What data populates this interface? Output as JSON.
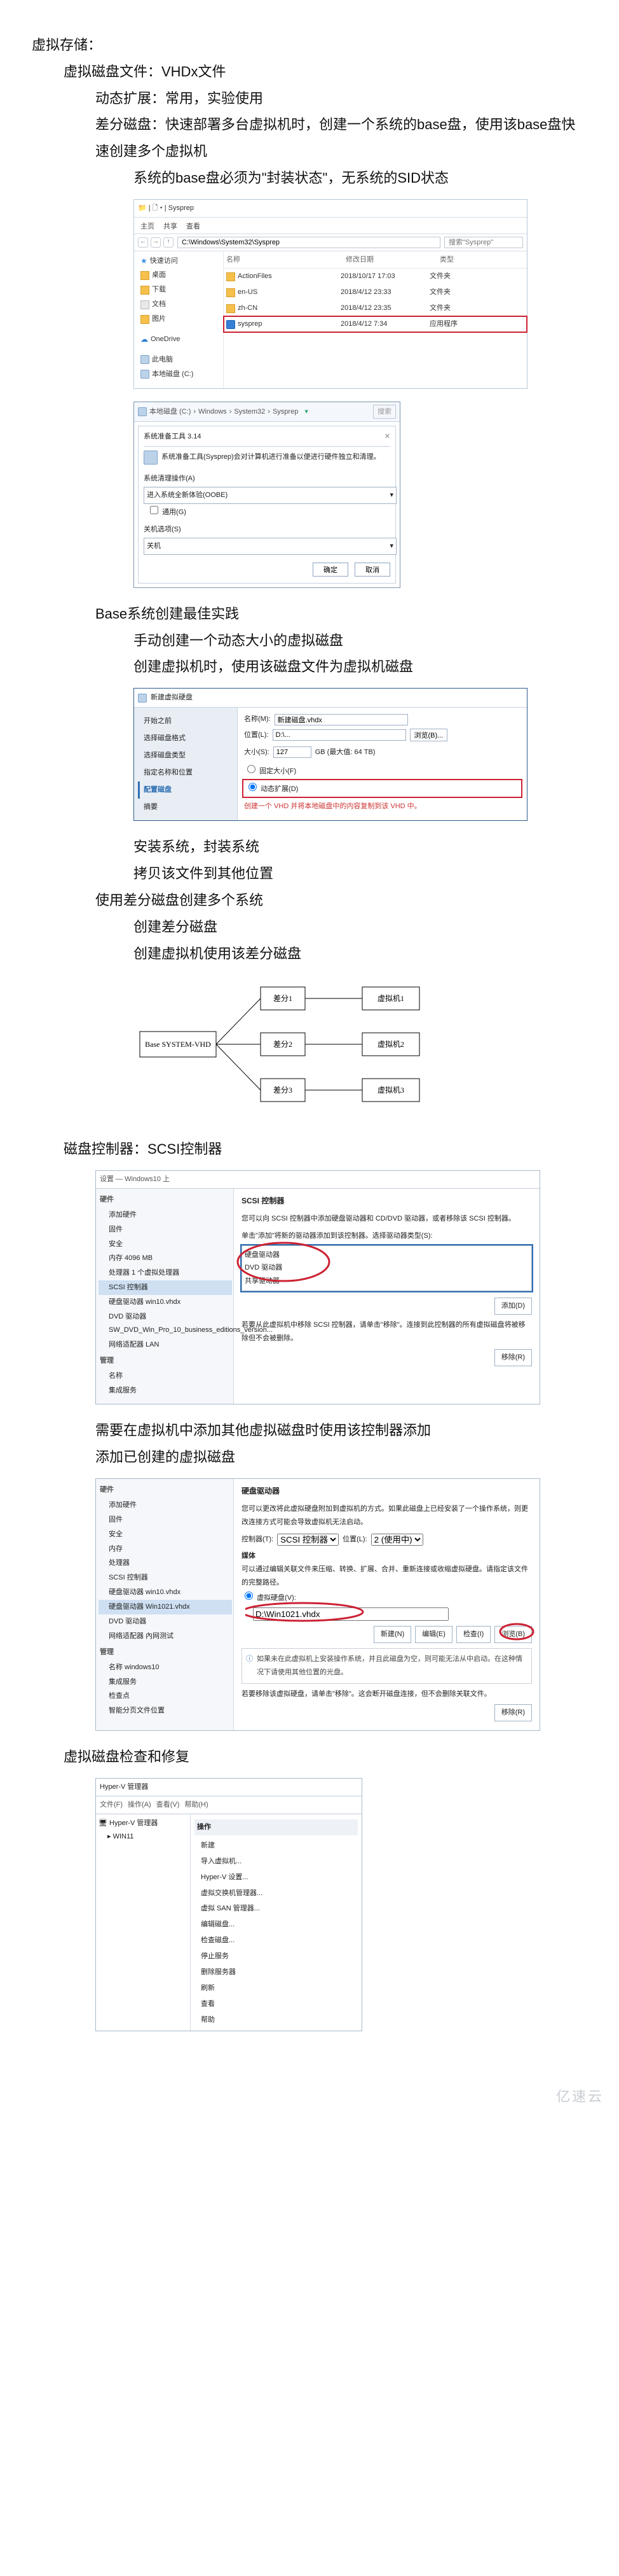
{
  "text": {
    "t0": "虚拟存储：",
    "t1": "虚拟磁盘文件：VHDx文件",
    "t2": "动态扩展：常用，实验使用",
    "t3": "差分磁盘：快速部署多台虚拟机时，创建一个系统的base盘，使用该base盘快速创建多个虚拟机",
    "t4": "系统的base盘必须为\"封装状态\"，无系统的SID状态",
    "t5": "Base系统创建最佳实践",
    "t6": "手动创建一个动态大小的虚拟磁盘",
    "t7": "创建虚拟机时，使用该磁盘文件为虚拟机磁盘",
    "t8": "安装系统，封装系统",
    "t9": "拷贝该文件到其他位置",
    "t10": "使用差分磁盘创建多个系统",
    "t11": "创建差分磁盘",
    "t12": "创建虚拟机使用该差分磁盘",
    "t13": "磁盘控制器：SCSI控制器",
    "t14": "需要在虚拟机中添加其他虚拟磁盘时使用该控制器添加",
    "t15": "添加已创建的虚拟磁盘",
    "t16": "虚拟磁盘检查和修复"
  },
  "explorer": {
    "title_prefix": "📁 | 🗋 ▾ |",
    "title": "Sysprep",
    "tabs": [
      "主页",
      "共享",
      "查看"
    ],
    "path": "C:\\Windows\\System32\\Sysprep",
    "search_placeholder": "搜索\"Sysprep\"",
    "cols": {
      "name": "名称",
      "date": "修改日期",
      "type": "类型"
    },
    "tree": [
      {
        "icon": "star",
        "label": "快速访问"
      },
      {
        "icon": "folder",
        "label": "桌面"
      },
      {
        "icon": "folder",
        "label": "下载"
      },
      {
        "icon": "file",
        "label": "文档"
      },
      {
        "icon": "folder",
        "label": "图片"
      },
      {
        "icon": "cloud",
        "label": "OneDrive"
      },
      {
        "icon": "drive",
        "label": "此电脑"
      },
      {
        "icon": "drive",
        "label": "本地磁盘 (C:)"
      }
    ],
    "rows": [
      {
        "icon": "folder",
        "name": "ActionFiles",
        "date": "2018/10/17 17:03",
        "type": "文件夹"
      },
      {
        "icon": "folder",
        "name": "en-US",
        "date": "2018/4/12 23:33",
        "type": "文件夹"
      },
      {
        "icon": "folder",
        "name": "zh-CN",
        "date": "2018/4/12 23:35",
        "type": "文件夹"
      },
      {
        "icon": "app",
        "name": "sysprep",
        "date": "2018/4/12 7:34",
        "type": "应用程序"
      }
    ]
  },
  "sysprep": {
    "crumbs": [
      "本地磁盘 (C:)",
      "Windows",
      "System32",
      "Sysprep"
    ],
    "srchph": "搜索",
    "title": "系统准备工具 3.14",
    "desc": "系统准备工具(Sysprep)会对计算机进行准备以便进行硬件独立和清理。",
    "f1": "系统清理操作(A)",
    "sel1": "进入系统全新体验(OOBE)",
    "chk": "通用(G)",
    "f2": "关机选项(S)",
    "sel2": "关机",
    "ok": "确定",
    "cancel": "取消"
  },
  "newvhd": {
    "title": "新建虚拟硬盘",
    "steps": [
      "开始之前",
      "选择磁盘格式",
      "选择磁盘类型",
      "指定名称和位置",
      "配置磁盘",
      "摘要"
    ],
    "cur": 4,
    "nameL": "名称(M):",
    "nameV": "新建磁盘.vhdx",
    "locL": "位置(L):",
    "locV": "D:\\...",
    "browse": "浏览(B)...",
    "sizeL": "大小(S):",
    "sizeV": "127",
    "sizeU": "GB (最大值: 64 TB)",
    "opt_fixed": "固定大小(F)",
    "opt_dyn": "动态扩展(D)",
    "note": "创建一个 VHD 并将本地磁盘中的内容复制到该 VHD 中。"
  },
  "diff": {
    "base": "Base SYSTEM-VHD",
    "d": [
      "差分1",
      "差分2",
      "差分3"
    ],
    "v": [
      "虚拟机1",
      "虚拟机2",
      "虚拟机3"
    ]
  },
  "scsi1": {
    "bar": "设置 — Windows10 上",
    "tree_hw": "硬件",
    "items_hw": [
      "添加硬件",
      "固件",
      "安全",
      "内存  4096 MB",
      "处理器  1 个虚拟处理器",
      "SCSI 控制器",
      "硬盘驱动器  win10.vhdx",
      "DVD 驱动器  SW_DVD_Win_Pro_10_business_editions_version...",
      "网络适配器  LAN"
    ],
    "tree_mg": "管理",
    "items_mg": [
      "名称",
      "集成服务"
    ],
    "pane_title": "SCSI 控制器",
    "pane_desc": "您可以向 SCSI 控制器中添加硬盘驱动器和 CD/DVD 驱动器，或者移除该 SCSI 控制器。",
    "pane_sub": "单击\"添加\"将新的驱动器添加到该控制器。选择驱动器类型(S):",
    "listbox": [
      "硬盘驱动器",
      "DVD 驱动器",
      "共享驱动器"
    ],
    "note2": "若要从此虚拟机中移除 SCSI 控制器，请单击\"移除\"。连接到此控制器的所有虚拟磁盘将被移除但不会被删除。",
    "add": "添加(D)",
    "remove": "移除(R)"
  },
  "scsi2": {
    "tree_hw": "硬件",
    "items_hw": [
      "添加硬件",
      "固件",
      "安全",
      "内存",
      "处理器",
      "SCSI 控制器",
      "硬盘驱动器  win10.vhdx",
      "硬盘驱动器  Win1021.vhdx",
      "DVD 驱动器",
      "网络适配器  內网测试"
    ],
    "tree_mg": "管理",
    "items_mg": [
      "名称  windows10",
      "集成服务",
      "检查点",
      "智能分页文件位置"
    ],
    "pane_title": "硬盘驱动器",
    "pane_desc": "您可以更改将此虚拟硬盘附加到虚拟机的方式。如果此磁盘上已经安装了一个操作系统，则更改连接方式可能会导致虚拟机无法启动。",
    "ctrlL": "控制器(T):",
    "ctrlV": "SCSI 控制器",
    "posL": "位置(L):",
    "posV": "2 (使用中)",
    "media": "媒体",
    "mediaDesc": "可以通过编辑关联文件来压缩、转换、扩展、合并、重新连接或收缩虚拟硬盘。请指定该文件的完整路径。",
    "optVhd": "虚拟硬盘(V):",
    "vhdPath": "D:\\Win1021.vhdx",
    "btns": [
      "新建(N)",
      "编辑(E)",
      "检查(I)",
      "浏览(B)"
    ],
    "note": "如果未在此虚拟机上安装操作系统，并且此磁盘为空，则可能无法从中启动。在这种情况下请使用其他位置的光盘。",
    "remove_txt": "若要移除该虚拟硬盘，请单击\"移除\"。这会断开磁盘连接，但不会删除关联文件。",
    "remove": "移除(R)"
  },
  "hvmgr": {
    "title": "Hyper-V 管理器",
    "menu": [
      "文件(F)",
      "操作(A)",
      "查看(V)",
      "帮助(H)"
    ],
    "left_root": "Hyper-V 管理器",
    "left_item": "WIN11",
    "section": "操作",
    "actions": [
      "新建",
      "导入虚拟机...",
      "Hyper-V 设置...",
      "虚拟交换机管理器...",
      "虚拟 SAN 管理器...",
      "编辑磁盘...",
      "检查磁盘...",
      "停止服务",
      "删除服务器",
      "刷新",
      "查看",
      "帮助"
    ]
  },
  "watermark": "亿速云"
}
